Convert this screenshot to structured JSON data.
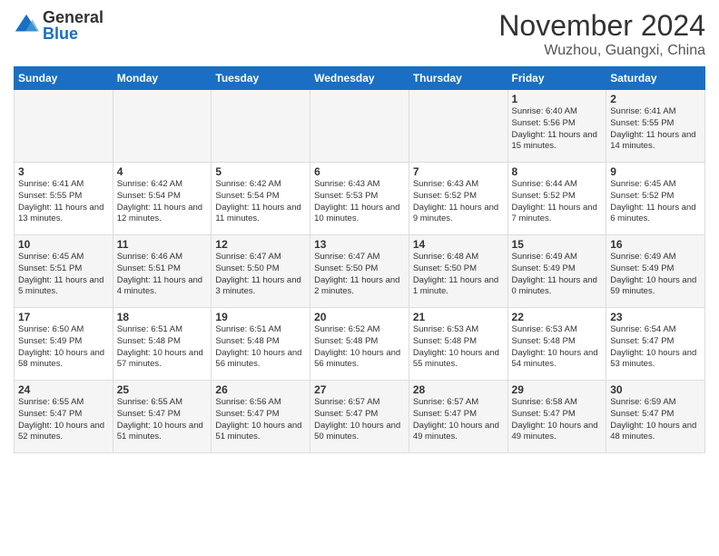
{
  "header": {
    "logo_general": "General",
    "logo_blue": "Blue",
    "title": "November 2024",
    "subtitle": "Wuzhou, Guangxi, China"
  },
  "days_of_week": [
    "Sunday",
    "Monday",
    "Tuesday",
    "Wednesday",
    "Thursday",
    "Friday",
    "Saturday"
  ],
  "weeks": [
    [
      {
        "day": "",
        "info": ""
      },
      {
        "day": "",
        "info": ""
      },
      {
        "day": "",
        "info": ""
      },
      {
        "day": "",
        "info": ""
      },
      {
        "day": "",
        "info": ""
      },
      {
        "day": "1",
        "info": "Sunrise: 6:40 AM\nSunset: 5:56 PM\nDaylight: 11 hours and 15 minutes."
      },
      {
        "day": "2",
        "info": "Sunrise: 6:41 AM\nSunset: 5:55 PM\nDaylight: 11 hours and 14 minutes."
      }
    ],
    [
      {
        "day": "3",
        "info": "Sunrise: 6:41 AM\nSunset: 5:55 PM\nDaylight: 11 hours and 13 minutes."
      },
      {
        "day": "4",
        "info": "Sunrise: 6:42 AM\nSunset: 5:54 PM\nDaylight: 11 hours and 12 minutes."
      },
      {
        "day": "5",
        "info": "Sunrise: 6:42 AM\nSunset: 5:54 PM\nDaylight: 11 hours and 11 minutes."
      },
      {
        "day": "6",
        "info": "Sunrise: 6:43 AM\nSunset: 5:53 PM\nDaylight: 11 hours and 10 minutes."
      },
      {
        "day": "7",
        "info": "Sunrise: 6:43 AM\nSunset: 5:52 PM\nDaylight: 11 hours and 9 minutes."
      },
      {
        "day": "8",
        "info": "Sunrise: 6:44 AM\nSunset: 5:52 PM\nDaylight: 11 hours and 7 minutes."
      },
      {
        "day": "9",
        "info": "Sunrise: 6:45 AM\nSunset: 5:52 PM\nDaylight: 11 hours and 6 minutes."
      }
    ],
    [
      {
        "day": "10",
        "info": "Sunrise: 6:45 AM\nSunset: 5:51 PM\nDaylight: 11 hours and 5 minutes."
      },
      {
        "day": "11",
        "info": "Sunrise: 6:46 AM\nSunset: 5:51 PM\nDaylight: 11 hours and 4 minutes."
      },
      {
        "day": "12",
        "info": "Sunrise: 6:47 AM\nSunset: 5:50 PM\nDaylight: 11 hours and 3 minutes."
      },
      {
        "day": "13",
        "info": "Sunrise: 6:47 AM\nSunset: 5:50 PM\nDaylight: 11 hours and 2 minutes."
      },
      {
        "day": "14",
        "info": "Sunrise: 6:48 AM\nSunset: 5:50 PM\nDaylight: 11 hours and 1 minute."
      },
      {
        "day": "15",
        "info": "Sunrise: 6:49 AM\nSunset: 5:49 PM\nDaylight: 11 hours and 0 minutes."
      },
      {
        "day": "16",
        "info": "Sunrise: 6:49 AM\nSunset: 5:49 PM\nDaylight: 10 hours and 59 minutes."
      }
    ],
    [
      {
        "day": "17",
        "info": "Sunrise: 6:50 AM\nSunset: 5:49 PM\nDaylight: 10 hours and 58 minutes."
      },
      {
        "day": "18",
        "info": "Sunrise: 6:51 AM\nSunset: 5:48 PM\nDaylight: 10 hours and 57 minutes."
      },
      {
        "day": "19",
        "info": "Sunrise: 6:51 AM\nSunset: 5:48 PM\nDaylight: 10 hours and 56 minutes."
      },
      {
        "day": "20",
        "info": "Sunrise: 6:52 AM\nSunset: 5:48 PM\nDaylight: 10 hours and 56 minutes."
      },
      {
        "day": "21",
        "info": "Sunrise: 6:53 AM\nSunset: 5:48 PM\nDaylight: 10 hours and 55 minutes."
      },
      {
        "day": "22",
        "info": "Sunrise: 6:53 AM\nSunset: 5:48 PM\nDaylight: 10 hours and 54 minutes."
      },
      {
        "day": "23",
        "info": "Sunrise: 6:54 AM\nSunset: 5:47 PM\nDaylight: 10 hours and 53 minutes."
      }
    ],
    [
      {
        "day": "24",
        "info": "Sunrise: 6:55 AM\nSunset: 5:47 PM\nDaylight: 10 hours and 52 minutes."
      },
      {
        "day": "25",
        "info": "Sunrise: 6:55 AM\nSunset: 5:47 PM\nDaylight: 10 hours and 51 minutes."
      },
      {
        "day": "26",
        "info": "Sunrise: 6:56 AM\nSunset: 5:47 PM\nDaylight: 10 hours and 51 minutes."
      },
      {
        "day": "27",
        "info": "Sunrise: 6:57 AM\nSunset: 5:47 PM\nDaylight: 10 hours and 50 minutes."
      },
      {
        "day": "28",
        "info": "Sunrise: 6:57 AM\nSunset: 5:47 PM\nDaylight: 10 hours and 49 minutes."
      },
      {
        "day": "29",
        "info": "Sunrise: 6:58 AM\nSunset: 5:47 PM\nDaylight: 10 hours and 49 minutes."
      },
      {
        "day": "30",
        "info": "Sunrise: 6:59 AM\nSunset: 5:47 PM\nDaylight: 10 hours and 48 minutes."
      }
    ]
  ]
}
